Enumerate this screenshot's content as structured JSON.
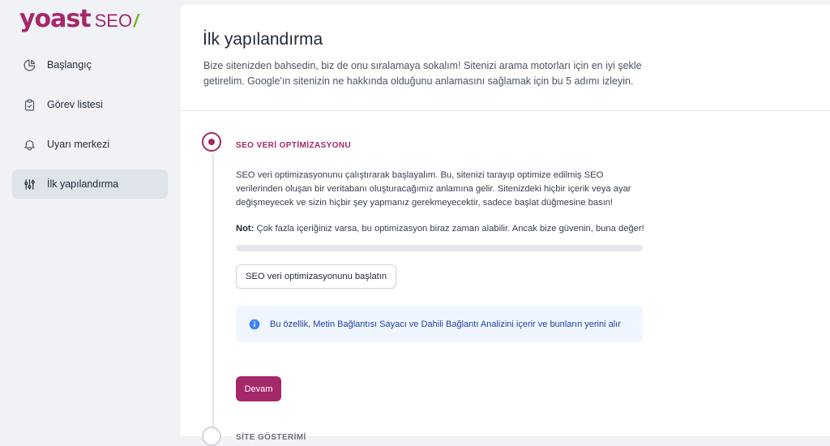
{
  "brand": {
    "name": "yoast",
    "product": "SEO",
    "slash": "/"
  },
  "sidebar": {
    "items": [
      {
        "label": "Başlangıç",
        "icon": "chart-pie-icon",
        "active": false
      },
      {
        "label": "Görev listesi",
        "icon": "clipboard-check-icon",
        "active": false
      },
      {
        "label": "Uyarı merkezi",
        "icon": "bell-icon",
        "active": false
      },
      {
        "label": "İlk yapılandırma",
        "icon": "sliders-icon",
        "active": true
      }
    ]
  },
  "main": {
    "title": "İlk yapılandırma",
    "description": "Bize sitenizden bahsedin, biz de onu sıralamaya sokalım! Sitenizi arama motorları için en iyi şekle getirelim. Google'ın sitenizin ne hakkında olduğunu anlamasını sağlamak için bu 5 adımı izleyin.",
    "step1": {
      "title": "SEO VERİ OPTİMİZASYONU",
      "body": "SEO veri optimizasyonunu çalıştırarak başlayalım. Bu, sitenizi tarayıp optimize edilmiş SEO verilerinden oluşan bir veritabanı oluşturacağımız anlamına gelir. Sitenizdeki hiçbir içerik veya ayar değişmeyecek ve sizin hiçbir şey yapmanız gerekmeyecektir, sadece başlat düğmesine basın!",
      "note_label": "Not:",
      "note_text": " Çok fazla içeriğiniz varsa, bu optimizasyon biraz zaman alabilir. Ancak bize güvenin, buna değer!",
      "progress": 0,
      "start_button": "SEO veri optimizasyonunu başlatın",
      "alert_text": "Bu özellik, Metin Bağlantısı Sayacı ve Dahili Bağlantı Analizini içerir ve bunların yerini alır",
      "continue_button": "Devam"
    },
    "step2": {
      "title": "SİTE GÖSTERİMİ"
    }
  },
  "colors": {
    "brand": "#a4286a",
    "slash": "#77b227",
    "alert_bg": "#eff6ff",
    "alert_text": "#1e40af"
  }
}
